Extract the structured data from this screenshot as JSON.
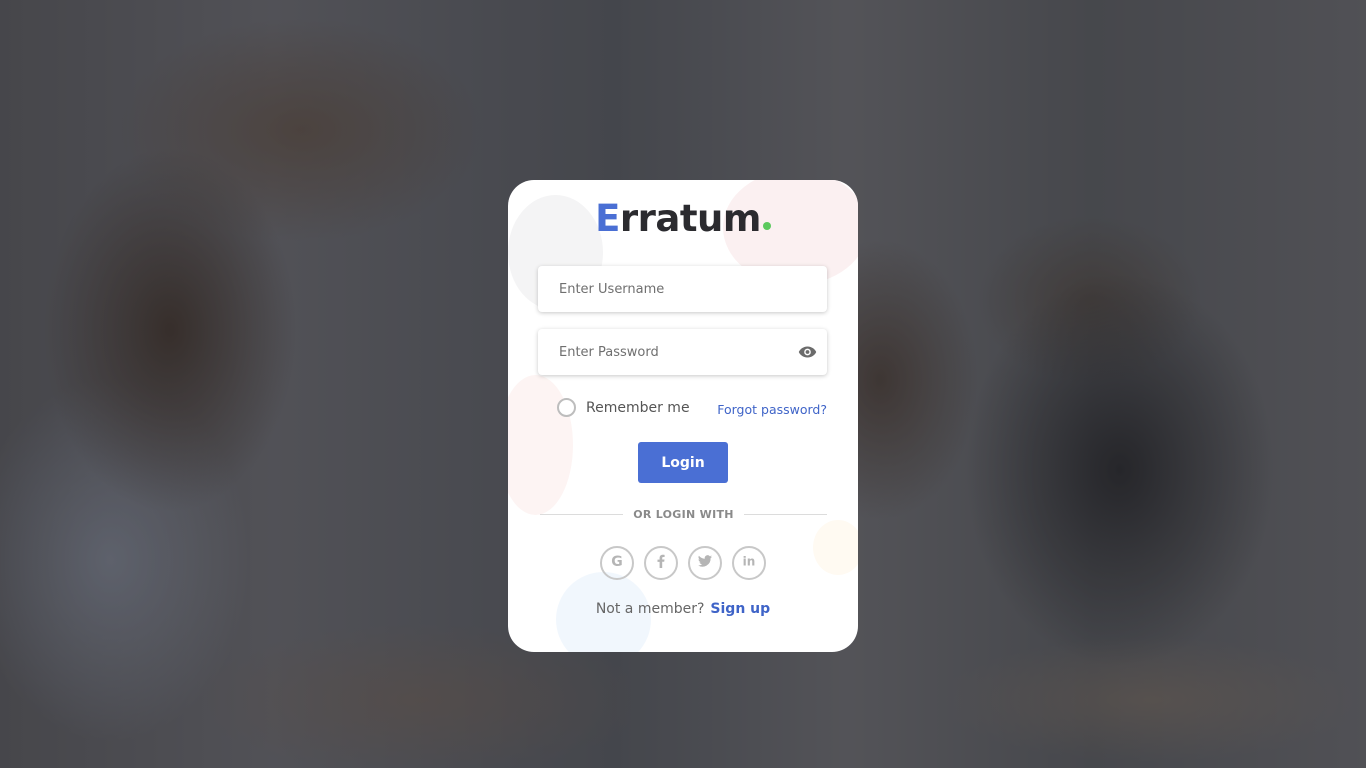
{
  "brand": {
    "name_initial": "E",
    "name_rest": "rratum",
    "accent_color": "#4a6fd4",
    "dot_color": "#5cc95e"
  },
  "form": {
    "username_placeholder": "Enter Username",
    "username_value": "",
    "password_placeholder": "Enter Password",
    "password_value": "",
    "password_toggle_icon": "eye-icon",
    "remember_label": "Remember me",
    "remember_checked": false,
    "forgot_label": "Forgot password?",
    "login_label": "Login"
  },
  "social": {
    "divider_label": "OR LOGIN WITH",
    "providers": [
      {
        "name": "google",
        "icon": "google-icon"
      },
      {
        "name": "facebook",
        "icon": "facebook-icon"
      },
      {
        "name": "twitter",
        "icon": "twitter-icon"
      },
      {
        "name": "linkedin",
        "icon": "linkedin-icon"
      }
    ]
  },
  "footer": {
    "prompt": "Not a member?",
    "signup_label": "Sign up"
  }
}
